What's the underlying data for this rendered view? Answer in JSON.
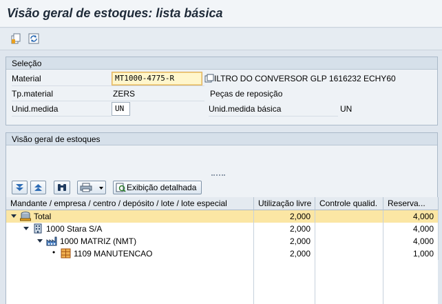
{
  "window": {
    "title": "Visão geral de estoques: lista básica"
  },
  "toolbar": {
    "icons": [
      "new-document-icon",
      "refresh-icon"
    ]
  },
  "selection": {
    "header": "Seleção",
    "material_label": "Material",
    "material_value": "MT1000-4775-R",
    "material_desc": "ILTRO DO CONVERSOR GLP 1616232 ECHY60",
    "tpmaterial_label": "Tp.material",
    "tpmaterial_value": "ZERS",
    "tpmaterial_desc": "Peças de reposição",
    "unid_label": "Unid.medida",
    "unid_value": "UN",
    "unid_basica_label": "Unid.medida básica",
    "unid_basica_value": "UN"
  },
  "overview": {
    "header": "Visão geral de estoques",
    "detail_button": "Exibição detalhada",
    "columns": [
      "Mandante / empresa / centro / depósito / lote / lote especial",
      "Utilização livre",
      "Controle qualid.",
      "Reserva..."
    ],
    "rows": [
      {
        "name": "Total",
        "livre": "2,000",
        "qualid": "",
        "reserva": "4,000"
      },
      {
        "name": "1000 Stara S/A",
        "livre": "2,000",
        "qualid": "",
        "reserva": "4,000"
      },
      {
        "name": "1000 MATRIZ (NMT)",
        "livre": "2,000",
        "qualid": "",
        "reserva": "4,000"
      },
      {
        "name": "1109 MANUTENCAO",
        "livre": "2,000",
        "qualid": "",
        "reserva": "1,000"
      }
    ]
  },
  "colors": {
    "total_row": "#fbe6a4",
    "accent": "#1e2a38"
  }
}
